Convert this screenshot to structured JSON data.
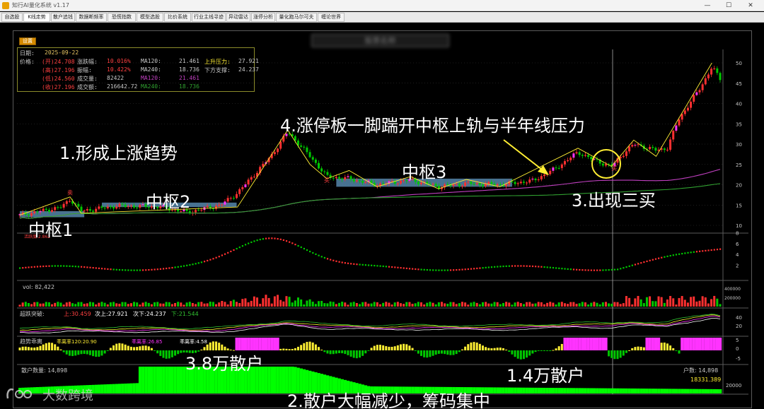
{
  "window": {
    "title": "知行AI量化系统 v1.17",
    "minimize": "—",
    "maximize": "☐",
    "close": "✕"
  },
  "tabs": [
    "自选股",
    "K线走势",
    "散户追钱",
    "数据断频率",
    "恐慌指数",
    "模型选股",
    "比价系统",
    "行业主线寻迹",
    "异动雷达",
    "涨停分析",
    "量化跑马尔可夫",
    "缠论世界"
  ],
  "settings_label": "设置",
  "stock_name": "股票名称",
  "infobox": {
    "date_label": "日期:",
    "date": "2025-09-22",
    "price_label": "价格:",
    "open": "(开)24.708",
    "high": "(高)27.196",
    "low": "(低)24.560",
    "close": "(收)27.196",
    "chg_label": "涨跌幅:",
    "chg": "10.016%",
    "amp_label": "振幅:",
    "amp": "10.422%",
    "vol_label": "成交量:",
    "vol": "82422",
    "amt_label": "成交额:",
    "amt": "216642.72",
    "ma120_label": "MA120:",
    "ma120": "21.461",
    "ma240_label": "MA240:",
    "ma240": "18.736",
    "ma120b_label": "MA120:",
    "ma120b": "21.461",
    "ma240b_label": "MA240:",
    "ma240b": "18.736",
    "up_res_label": "上升压力:",
    "up_res": "27.921",
    "down_sup_label": "下方支撑:",
    "down_sup": "24.237"
  },
  "price_axis": [
    "50",
    "45",
    "40",
    "35",
    "30",
    "25",
    "20",
    "15",
    "10"
  ],
  "ind1_axis": [
    "8",
    "6",
    "4",
    "2"
  ],
  "vol_axis": [
    "400000",
    "200000"
  ],
  "ind3_axis": [
    "40",
    "20"
  ],
  "ind4_axis": [
    "5",
    "0",
    "-5"
  ],
  "ind5_axis": [
    "20000"
  ],
  "panels": {
    "ind1_label": "活跃度 2.862",
    "vol_label": "vol: 82,422",
    "ind3": {
      "name": "超跌突破:",
      "a": "上:30.459",
      "b": "次上:27.921",
      "c": "次下:24.237",
      "d": "下:21.544"
    },
    "ind4": {
      "name": "趋势乖离",
      "a": "乖离率120:20.90",
      "b": "乖离率:26.85",
      "c": "乖离率:4.58"
    },
    "ind5_label": "散户数量: 14,898",
    "ind5_right1": "户数: 14,898",
    "ind5_right2": "18331.389"
  },
  "annotations": {
    "a1": "1.形成上涨趋势",
    "a2": "2.散户大幅减少，筹码集中",
    "a3": "3.出现三买",
    "a4": "4.涨停板一脚踹开中枢上轨与半年线压力",
    "zs1": "中枢1",
    "zs2": "中枢2",
    "zs3": "中枢3",
    "r1": "3.8万散户",
    "r2": "1.4万散户",
    "sell_mark": "卖",
    "buy_mark": "买"
  },
  "watermark": "大数跨境",
  "colors": {
    "up": "#ff3030",
    "down": "#00c800",
    "ma_purple": "#c040c0",
    "ma_green": "#30a030",
    "magenta": "#ff33ff",
    "zone_blue": "#5a8fb5",
    "accent_yellow": "#ffee33"
  }
}
